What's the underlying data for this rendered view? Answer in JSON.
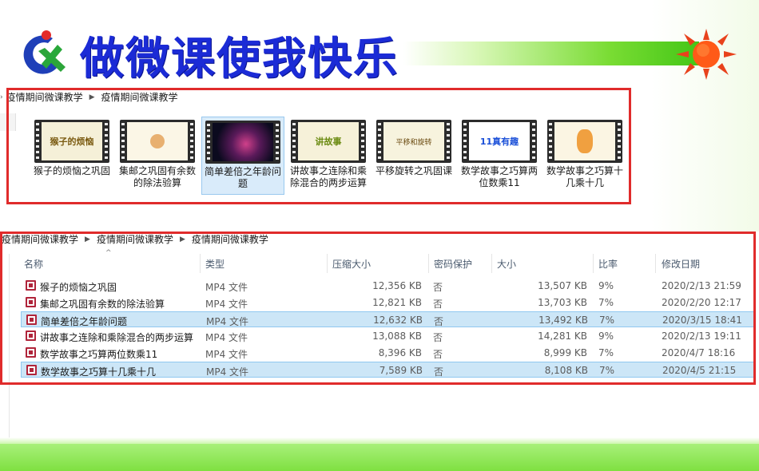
{
  "slide": {
    "title": "做微课使我快乐",
    "colors": {
      "title": "#1b2bd6",
      "frame": "#e02b2b",
      "accent_green": "#7fe041"
    }
  },
  "top_explorer": {
    "breadcrumb": [
      "疫情期间微课教学",
      "疫情期间微课教学"
    ],
    "items": [
      {
        "label": "猴子的烦恼之巩固",
        "icon": "video-thumbnail-icon",
        "selected": false
      },
      {
        "label": "集邮之巩固有余数的除法验算",
        "icon": "video-thumbnail-icon",
        "selected": false
      },
      {
        "label": "简单差倍之年龄问题",
        "icon": "video-thumbnail-icon",
        "selected": true
      },
      {
        "label": "讲故事之连除和乘除混合的两步运算",
        "icon": "video-thumbnail-icon",
        "selected": false
      },
      {
        "label": "平移旋转之巩固课",
        "icon": "video-thumbnail-icon",
        "selected": false
      },
      {
        "label": "数学故事之巧算两位数乘11",
        "icon": "video-thumbnail-icon",
        "selected": false
      },
      {
        "label": "数学故事之巧算十几乘十几",
        "icon": "video-thumbnail-icon",
        "selected": false
      }
    ],
    "thumb_text": [
      "猴子的烦恼",
      "",
      "",
      "讲故事",
      "平移和旋转",
      "11真有趣",
      ""
    ]
  },
  "bottom_explorer": {
    "breadcrumb": [
      "疫情期间微课教学",
      "疫情期间微课教学",
      "疫情期间微课教学"
    ],
    "columns": [
      "名称",
      "类型",
      "压缩大小",
      "密码保护",
      "大小",
      "比率",
      "修改日期"
    ],
    "rows": [
      {
        "name": "猴子的烦恼之巩固",
        "type": "MP4 文件",
        "packed": "12,356 KB",
        "protected": "否",
        "size": "13,507 KB",
        "ratio": "9%",
        "modified": "2020/2/13 21:59",
        "selected": false
      },
      {
        "name": "集邮之巩固有余数的除法验算",
        "type": "MP4 文件",
        "packed": "12,821 KB",
        "protected": "否",
        "size": "13,703 KB",
        "ratio": "7%",
        "modified": "2020/2/20 12:17",
        "selected": false
      },
      {
        "name": "简单差倍之年龄问题",
        "type": "MP4 文件",
        "packed": "12,632 KB",
        "protected": "否",
        "size": "13,492 KB",
        "ratio": "7%",
        "modified": "2020/3/15 18:41",
        "selected": true
      },
      {
        "name": "讲故事之连除和乘除混合的两步运算",
        "type": "MP4 文件",
        "packed": "13,088 KB",
        "protected": "否",
        "size": "14,281 KB",
        "ratio": "9%",
        "modified": "2020/2/13 19:11",
        "selected": false
      },
      {
        "name": "数学故事之巧算两位数乘11",
        "type": "MP4 文件",
        "packed": "8,396 KB",
        "protected": "否",
        "size": "8,999 KB",
        "ratio": "7%",
        "modified": "2020/4/7 18:16",
        "selected": false
      },
      {
        "name": "数学故事之巧算十几乘十几",
        "type": "MP4 文件",
        "packed": "7,589 KB",
        "protected": "否",
        "size": "8,108 KB",
        "ratio": "7%",
        "modified": "2020/4/5 21:15",
        "selected": true
      }
    ]
  }
}
